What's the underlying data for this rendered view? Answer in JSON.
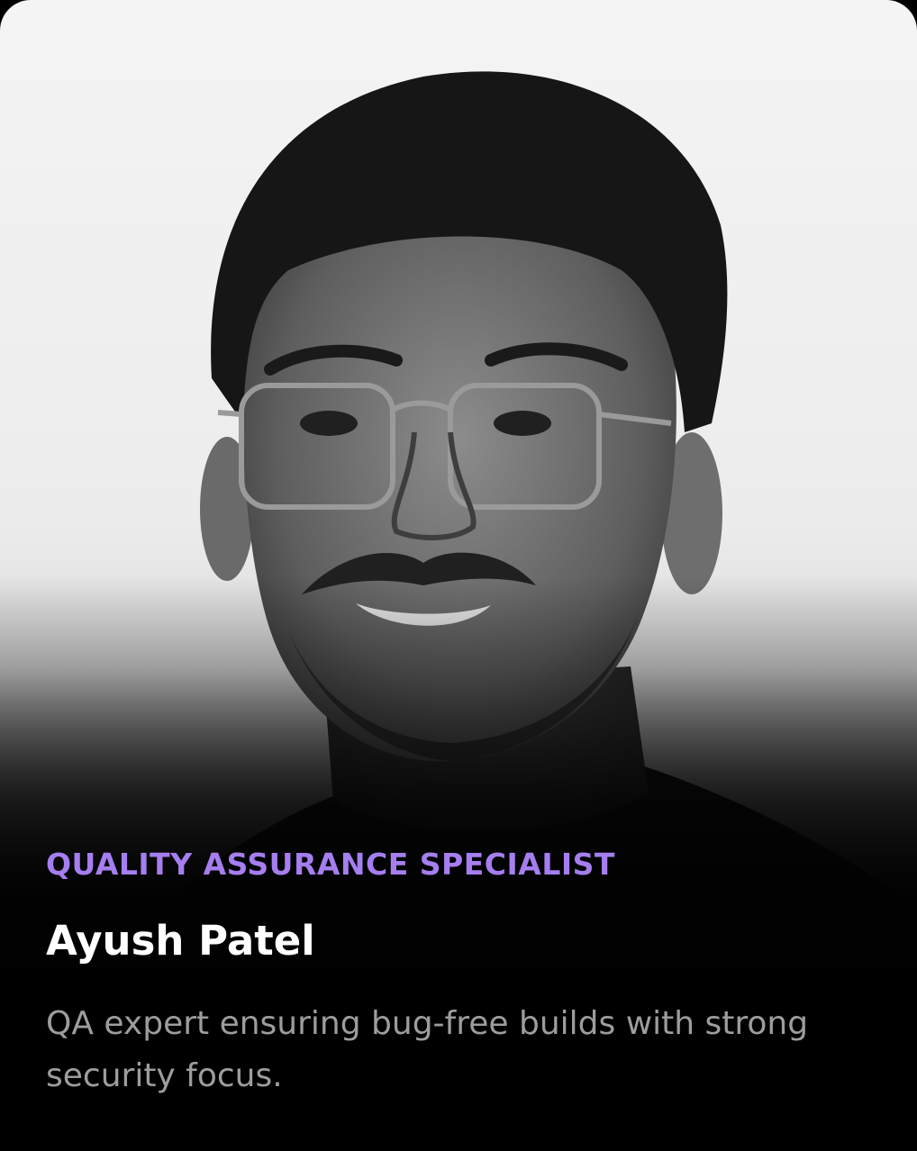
{
  "profile": {
    "role": "QUALITY ASSURANCE SPECIALIST",
    "name": "Ayush Patel",
    "bio": "QA expert ensuring bug-free builds with strong security focus."
  },
  "colors": {
    "accent": "#a57ef0",
    "name": "#ffffff",
    "bio": "#9d9d9d",
    "background": "#000000"
  }
}
